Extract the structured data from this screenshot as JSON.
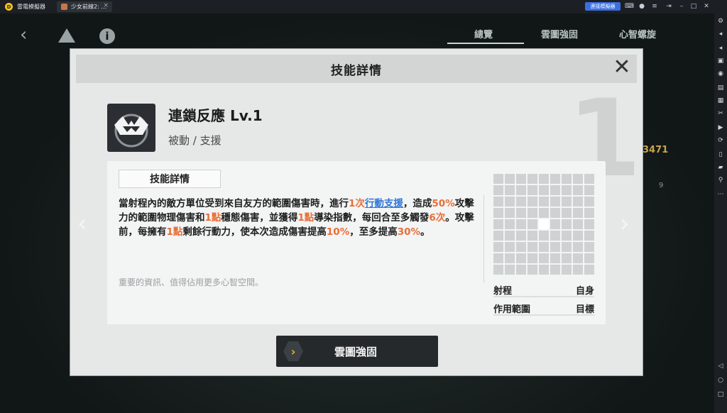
{
  "emulator": {
    "app_title": "雷電模擬器",
    "tab_label": "少女前線2: ...",
    "connect_label": "連接模擬器",
    "logo_glyph": "D"
  },
  "game_bg": {
    "tabs": [
      "總覽",
      "雲圖強固",
      "心智螺旋"
    ],
    "number": "3471",
    "small_number": "9"
  },
  "modal": {
    "title": "技能詳情",
    "close_glyph": "✕",
    "bg_number": "1",
    "skill": {
      "name": "連鎖反應 Lv.1",
      "type": "被動 / 支援"
    },
    "detail": {
      "tab_label": "技能詳情",
      "segments": [
        {
          "text": "當射程內的敵方單位受到來自友方的範圍傷害時，進行",
          "style": "normal"
        },
        {
          "text": "1次",
          "style": "hl"
        },
        {
          "text": "行動支援",
          "style": "lk"
        },
        {
          "text": "，造成",
          "style": "normal"
        },
        {
          "text": "50%",
          "style": "hl"
        },
        {
          "text": "攻擊力的範圍物理傷害和",
          "style": "normal"
        },
        {
          "text": "1點",
          "style": "hl"
        },
        {
          "text": "穩態傷害，並獲得",
          "style": "normal"
        },
        {
          "text": "1點",
          "style": "hl"
        },
        {
          "text": "導染指數，每回合至多觸發",
          "style": "normal"
        },
        {
          "text": "6次",
          "style": "hl"
        },
        {
          "text": "。攻擊前，每擁有",
          "style": "normal"
        },
        {
          "text": "1點",
          "style": "hl"
        },
        {
          "text": "剩餘行動力，使本次造成傷害提高",
          "style": "normal"
        },
        {
          "text": "10%",
          "style": "hl"
        },
        {
          "text": "，至多提高",
          "style": "normal"
        },
        {
          "text": "30%",
          "style": "hl"
        },
        {
          "text": "。",
          "style": "normal"
        }
      ],
      "note": "重要的資訊、值得佔用更多心智空間。"
    },
    "range": {
      "grid_size": 9,
      "self_cell": [
        4,
        4
      ],
      "range_label": "射程",
      "range_value": "自身",
      "area_label": "作用範圍",
      "area_value": "目標"
    },
    "action_button": {
      "label": "雲圖強固",
      "icon_glyph": "›"
    },
    "nav": {
      "prev": "‹",
      "next": "›"
    }
  },
  "colors": {
    "highlight": "#e86e37",
    "link": "#2f75d6",
    "button_icon": "#f1b227"
  }
}
